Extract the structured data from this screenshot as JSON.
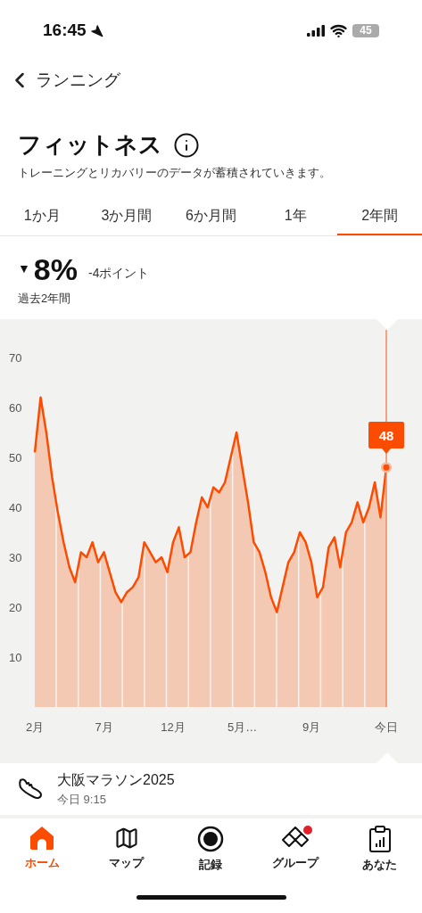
{
  "status_bar": {
    "time": "16:45",
    "battery": "45"
  },
  "header": {
    "back_label": "ランニング"
  },
  "title": "フィットネス",
  "subtitle": "トレーニングとリカバリーのデータが蓄積されていきます。",
  "tabs": [
    {
      "label": "1か月",
      "selected": false
    },
    {
      "label": "3か月間",
      "selected": false
    },
    {
      "label": "6か月間",
      "selected": false
    },
    {
      "label": "1年",
      "selected": false
    },
    {
      "label": "2年間",
      "selected": true
    }
  ],
  "summary": {
    "trend_marker": "▼",
    "value": "8%",
    "change": "-4ポイント",
    "period": "過去2年間"
  },
  "chart": {
    "chart_data": {
      "type": "area",
      "categories": [
        "2月",
        null,
        null,
        null,
        null,
        null,
        null,
        null,
        null,
        null,
        null,
        null,
        "7月",
        null,
        null,
        null,
        null,
        null,
        null,
        null,
        null,
        null,
        null,
        null,
        "12月",
        null,
        null,
        null,
        null,
        null,
        null,
        null,
        null,
        null,
        null,
        null,
        "5月…",
        null,
        null,
        null,
        null,
        null,
        null,
        null,
        null,
        null,
        null,
        null,
        "9月",
        null,
        null,
        null,
        null,
        null,
        null,
        null,
        null,
        null,
        null,
        null,
        null,
        "今日"
      ],
      "values": [
        51,
        62,
        55,
        46,
        39,
        33,
        28,
        25,
        31,
        30,
        33,
        29,
        31,
        27,
        23,
        21,
        23,
        24,
        26,
        33,
        31,
        29,
        30,
        27,
        33,
        36,
        30,
        31,
        37,
        42,
        40,
        44,
        43,
        45,
        50,
        55,
        48,
        41,
        33,
        31,
        27,
        22,
        19,
        24,
        29,
        31,
        35,
        33,
        29,
        22,
        24,
        32,
        34,
        28,
        35,
        37,
        41,
        37,
        40,
        45,
        38,
        48
      ],
      "ylim": [
        0,
        70
      ],
      "yticks": [
        10,
        20,
        30,
        40,
        50,
        60,
        70
      ],
      "annotations": [
        {
          "y": 48,
          "text": "48"
        }
      ]
    }
  },
  "activity": {
    "title": "大阪マラソン2025",
    "time": "今日 9:15"
  },
  "nav": [
    {
      "label": "ホーム",
      "kind": "home",
      "selected": true,
      "badge": false
    },
    {
      "label": "マップ",
      "kind": "map",
      "selected": false,
      "badge": false
    },
    {
      "label": "記録",
      "kind": "record",
      "selected": false,
      "badge": false
    },
    {
      "label": "グループ",
      "kind": "groups",
      "selected": false,
      "badge": true
    },
    {
      "label": "あなた",
      "kind": "you",
      "selected": false,
      "badge": false
    }
  ]
}
